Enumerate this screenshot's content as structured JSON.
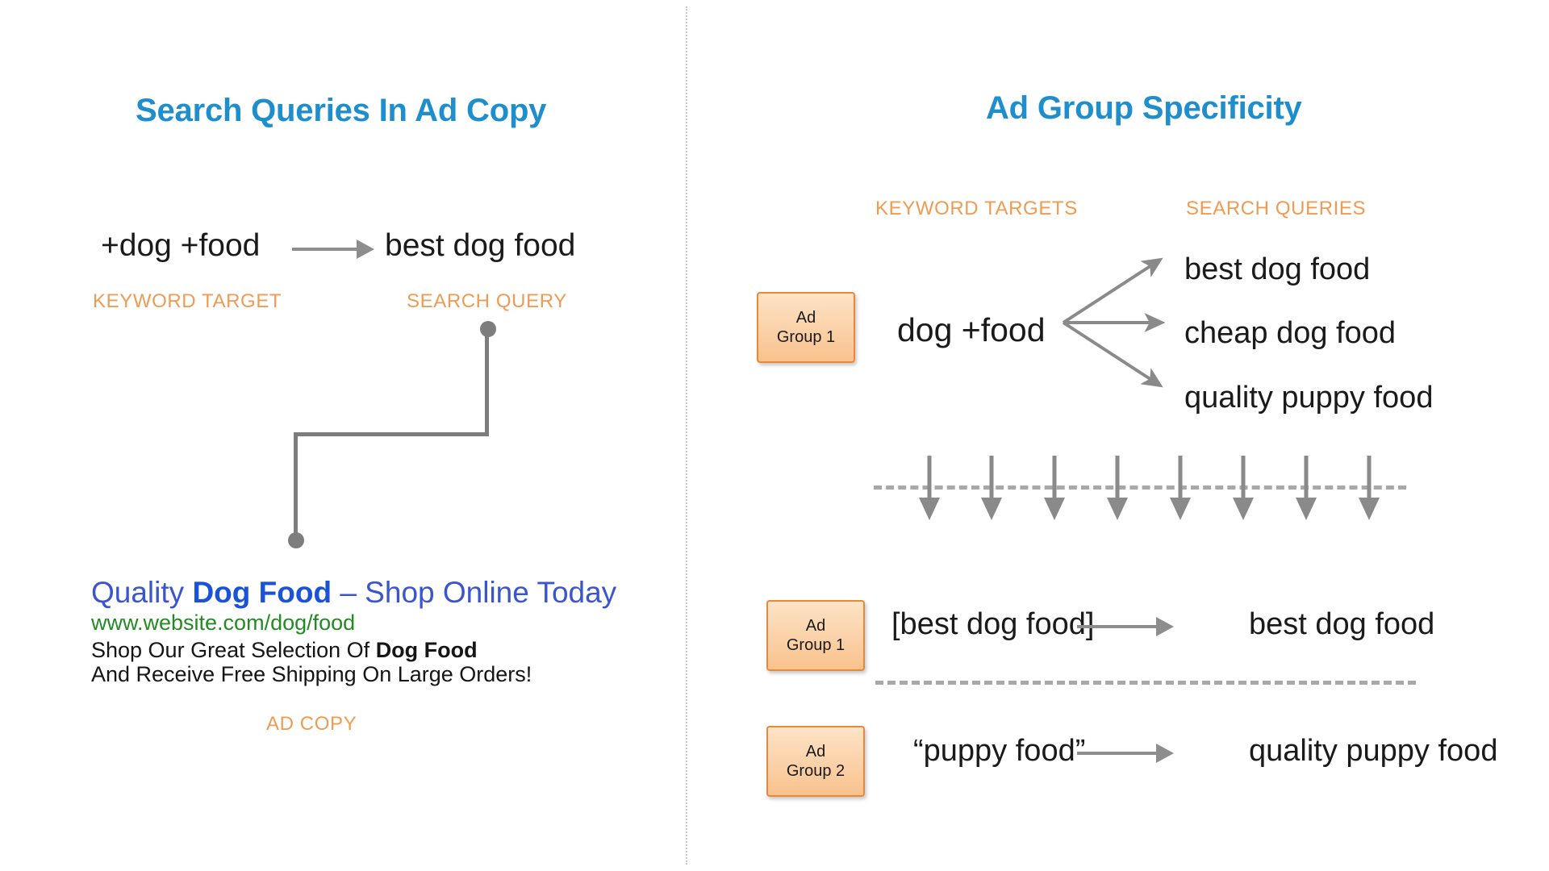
{
  "left_panel": {
    "title": "Search Queries In Ad Copy",
    "keyword_target_text": "+dog +food",
    "search_query_text": "best dog food",
    "keyword_target_label": "KEYWORD TARGET",
    "search_query_label": "SEARCH QUERY",
    "ad_copy_label": "AD COPY",
    "ad": {
      "headline_prefix": "Quality ",
      "headline_bold": "Dog Food",
      "headline_suffix": " – Shop Online Today",
      "url": "www.website.com/dog/food",
      "description_line1_prefix": "Shop Our Great Selection Of ",
      "description_line1_bold": "Dog Food",
      "description_line2": "And Receive Free Shipping On Large Orders!"
    }
  },
  "right_panel": {
    "title": "Ad Group Specificity",
    "column_labels": {
      "keyword_targets": "KEYWORD TARGETS",
      "search_queries": "SEARCH QUERIES"
    },
    "broad_group": {
      "box_line1": "Ad",
      "box_line2": "Group 1",
      "keyword": "dog +food",
      "queries": [
        "best dog food",
        "cheap dog food",
        "quality puppy food"
      ]
    },
    "specific_rows": [
      {
        "box_line1": "Ad",
        "box_line2": "Group 1",
        "keyword": "[best dog food]",
        "query": "best dog food"
      },
      {
        "box_line1": "Ad",
        "box_line2": "Group 2",
        "keyword": "“puppy food”",
        "query": "quality puppy food"
      }
    ],
    "transition_arrow_count": 8
  },
  "colors": {
    "title_blue": "#1E8FCC",
    "label_orange": "#EE9B54",
    "ad_headline_blue": "#3B55CC",
    "ad_url_green": "#248A24",
    "arrow_gray": "#8A8A8A",
    "adgroup_border": "#E8893A",
    "divider_gray": "#C9C9C9"
  }
}
